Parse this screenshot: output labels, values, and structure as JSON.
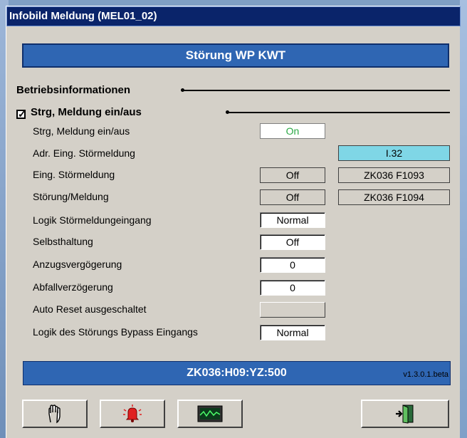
{
  "window": {
    "title": "Infobild Meldung (MEL01_02)"
  },
  "header": {
    "banner": "Störung WP KWT"
  },
  "sections": {
    "betrieb": "Betriebsinformationen",
    "strg": "Strg, Meldung ein/aus",
    "strg_checked": true
  },
  "rows": {
    "r1": {
      "label": "Strg, Meldung ein/aus",
      "value": "On"
    },
    "r2": {
      "label": "Adr. Eing. Störmeldung",
      "addr": "I.32"
    },
    "r3": {
      "label": "Eing. Störmeldung",
      "value": "Off",
      "addr": "ZK036 F1093"
    },
    "r4": {
      "label": "Störung/Meldung",
      "value": "Off",
      "addr": "ZK036 F1094"
    },
    "r5": {
      "label": "Logik Störmeldungeingang",
      "value": "Normal"
    },
    "r6": {
      "label": "Selbsthaltung",
      "value": "Off"
    },
    "r7": {
      "label": "Anzugsvergögerung",
      "value": "0"
    },
    "r8": {
      "label": "Abfallverzögerung",
      "value": "0"
    },
    "r9": {
      "label": "Auto Reset ausgeschaltet",
      "value": ""
    },
    "r10": {
      "label": "Logik des Störungs Bypass Eingangs",
      "value": "Normal"
    }
  },
  "footer": {
    "id": "ZK036:H09:YZ:500",
    "version": "v1.3.0.1.beta"
  },
  "toolbar": {
    "hand_icon": "hand-icon",
    "alarm_icon": "alarm-bell-icon",
    "trend_icon": "trend-monitor-icon",
    "exit_icon": "exit-door-icon"
  }
}
